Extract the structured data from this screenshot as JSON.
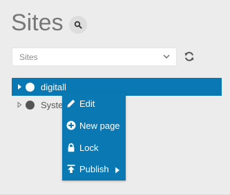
{
  "header": {
    "title": "Sites",
    "search_icon": "search-icon"
  },
  "site_selector": {
    "placeholder": "Sites",
    "chevron_icon": "chevron-down-icon",
    "refresh_icon": "refresh-icon"
  },
  "tree": {
    "items": [
      {
        "label": "digitall",
        "expander_icon": "caret-right-icon",
        "state": "selected",
        "status_color": "#ffffff"
      },
      {
        "label": "Syste",
        "expander_icon": "caret-right-outline-icon",
        "state": "normal",
        "status_color": "#555555"
      }
    ]
  },
  "context_menu": {
    "items": [
      {
        "label": "Edit",
        "icon": "pencil-icon"
      },
      {
        "label": "New page",
        "icon": "plus-circle-icon"
      },
      {
        "label": "Lock",
        "icon": "lock-icon"
      },
      {
        "label": "Publish",
        "icon": "publish-icon",
        "submenu_icon": "caret-right-icon"
      }
    ]
  },
  "colors": {
    "accent": "#0a79b3",
    "background": "#ececec",
    "title": "#777777"
  }
}
